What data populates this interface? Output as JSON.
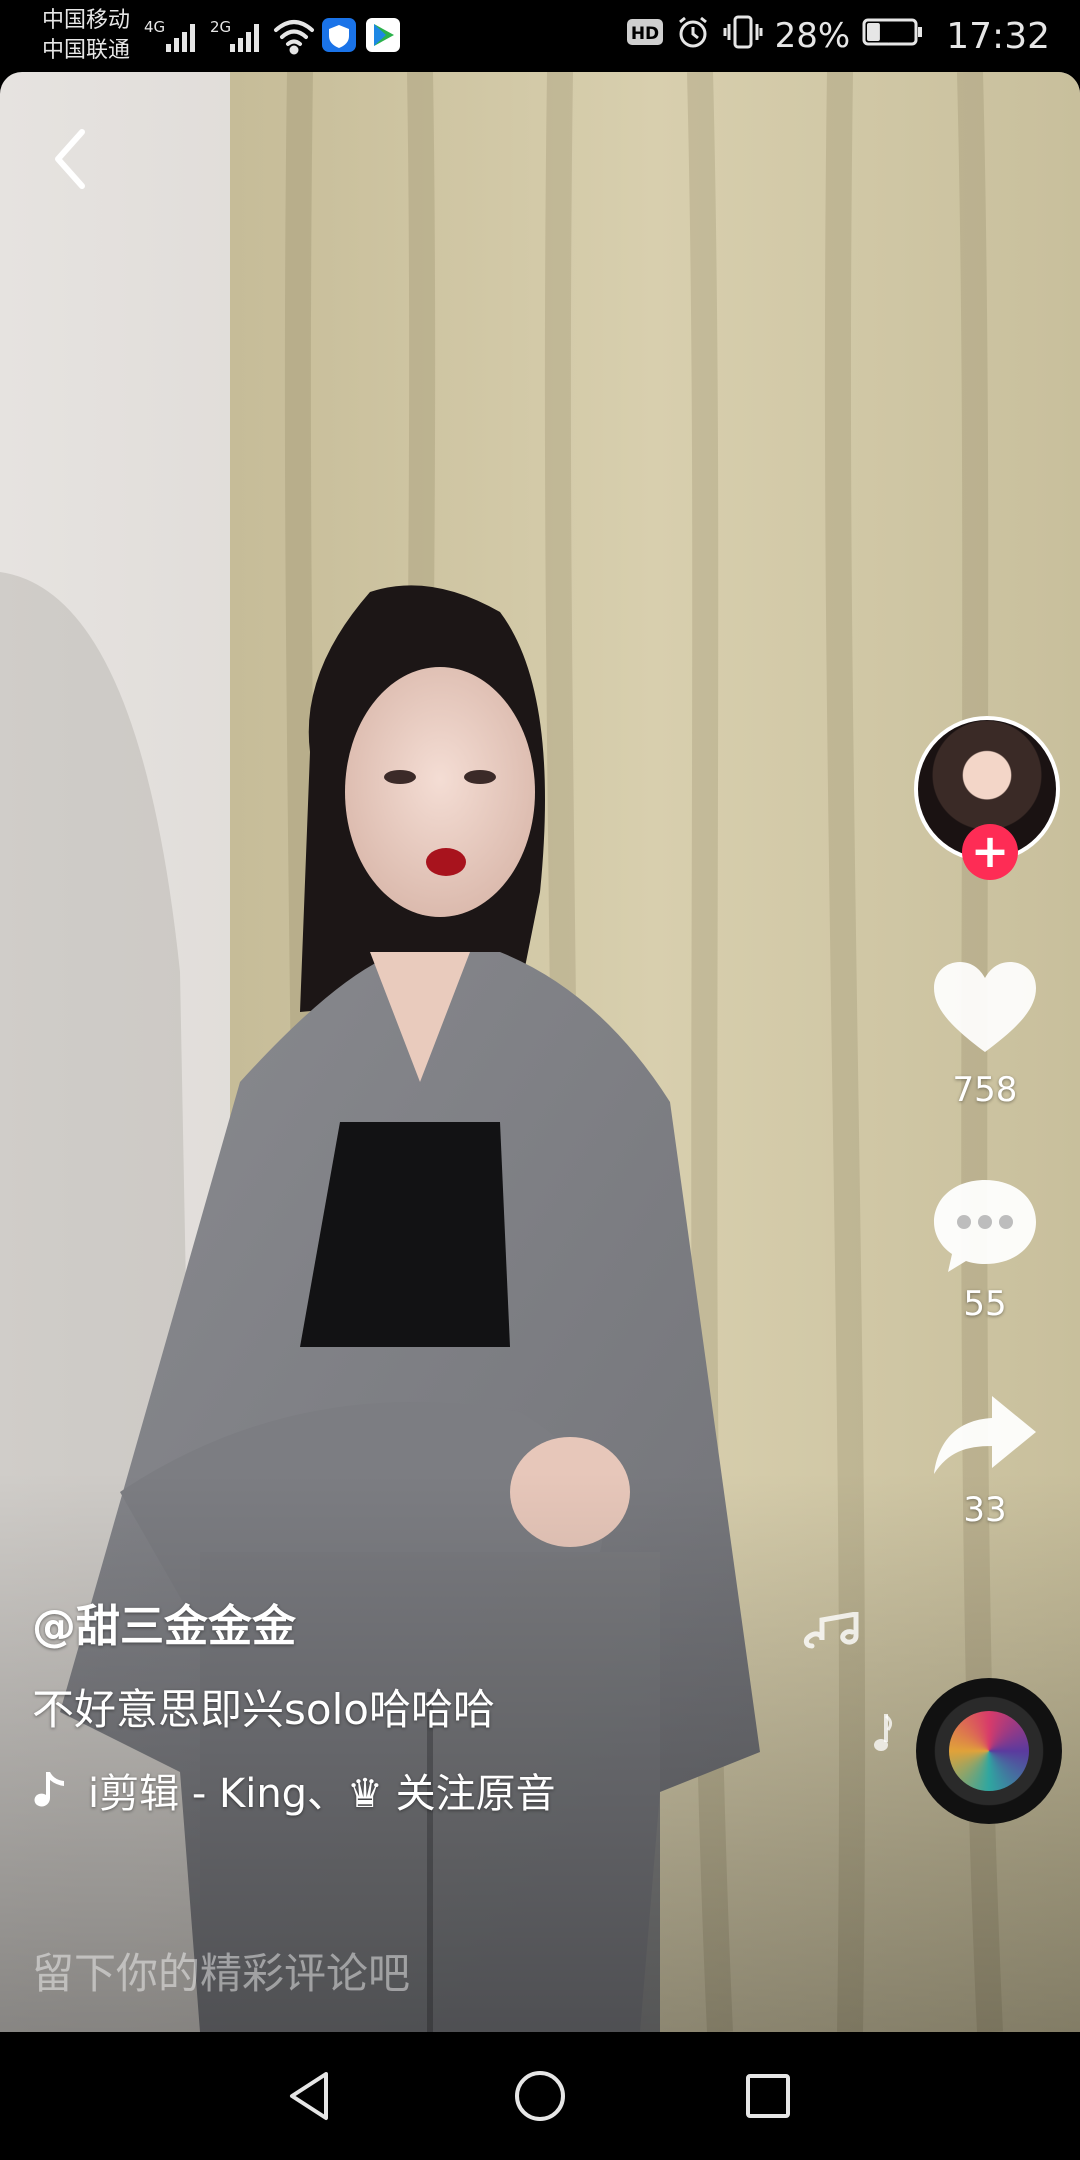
{
  "status_bar": {
    "carrier_1": "中国移动",
    "carrier_2": "中国联通",
    "net_1": "4G",
    "net_2": "2G",
    "hd": "HD",
    "battery_percent": "28%",
    "battery_level": 0.28,
    "time": "17:32"
  },
  "video": {
    "author": "@甜三金金金",
    "caption": "不好意思即兴solo哈哈哈",
    "music_text": "i剪辑 - King、♛   关注原音",
    "likes": "758",
    "comments": "55",
    "shares": "33",
    "comment_placeholder": "留下你的精彩评论吧"
  },
  "colors": {
    "accent": "#fe2c55",
    "background": "#000000",
    "text": "#ffffff"
  },
  "icons": {
    "back": "chevron-left-icon",
    "follow": "plus-icon",
    "like": "heart-icon",
    "comment": "speech-bubble-icon",
    "share": "share-arrow-icon",
    "music": "tiktok-note-icon",
    "nav_back": "triangle-back-icon",
    "nav_home": "circle-home-icon",
    "nav_recent": "square-recent-icon"
  }
}
